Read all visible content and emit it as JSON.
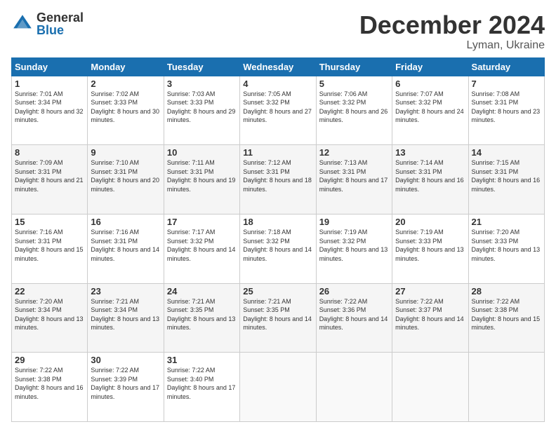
{
  "header": {
    "logo_general": "General",
    "logo_blue": "Blue",
    "month_title": "December 2024",
    "location": "Lyman, Ukraine"
  },
  "days_of_week": [
    "Sunday",
    "Monday",
    "Tuesday",
    "Wednesday",
    "Thursday",
    "Friday",
    "Saturday"
  ],
  "weeks": [
    [
      {
        "day": "1",
        "sunrise": "7:01 AM",
        "sunset": "3:34 PM",
        "daylight": "8 hours and 32 minutes."
      },
      {
        "day": "2",
        "sunrise": "7:02 AM",
        "sunset": "3:33 PM",
        "daylight": "8 hours and 30 minutes."
      },
      {
        "day": "3",
        "sunrise": "7:03 AM",
        "sunset": "3:33 PM",
        "daylight": "8 hours and 29 minutes."
      },
      {
        "day": "4",
        "sunrise": "7:05 AM",
        "sunset": "3:32 PM",
        "daylight": "8 hours and 27 minutes."
      },
      {
        "day": "5",
        "sunrise": "7:06 AM",
        "sunset": "3:32 PM",
        "daylight": "8 hours and 26 minutes."
      },
      {
        "day": "6",
        "sunrise": "7:07 AM",
        "sunset": "3:32 PM",
        "daylight": "8 hours and 24 minutes."
      },
      {
        "day": "7",
        "sunrise": "7:08 AM",
        "sunset": "3:31 PM",
        "daylight": "8 hours and 23 minutes."
      }
    ],
    [
      {
        "day": "8",
        "sunrise": "7:09 AM",
        "sunset": "3:31 PM",
        "daylight": "8 hours and 21 minutes."
      },
      {
        "day": "9",
        "sunrise": "7:10 AM",
        "sunset": "3:31 PM",
        "daylight": "8 hours and 20 minutes."
      },
      {
        "day": "10",
        "sunrise": "7:11 AM",
        "sunset": "3:31 PM",
        "daylight": "8 hours and 19 minutes."
      },
      {
        "day": "11",
        "sunrise": "7:12 AM",
        "sunset": "3:31 PM",
        "daylight": "8 hours and 18 minutes."
      },
      {
        "day": "12",
        "sunrise": "7:13 AM",
        "sunset": "3:31 PM",
        "daylight": "8 hours and 17 minutes."
      },
      {
        "day": "13",
        "sunrise": "7:14 AM",
        "sunset": "3:31 PM",
        "daylight": "8 hours and 16 minutes."
      },
      {
        "day": "14",
        "sunrise": "7:15 AM",
        "sunset": "3:31 PM",
        "daylight": "8 hours and 16 minutes."
      }
    ],
    [
      {
        "day": "15",
        "sunrise": "7:16 AM",
        "sunset": "3:31 PM",
        "daylight": "8 hours and 15 minutes."
      },
      {
        "day": "16",
        "sunrise": "7:16 AM",
        "sunset": "3:31 PM",
        "daylight": "8 hours and 14 minutes."
      },
      {
        "day": "17",
        "sunrise": "7:17 AM",
        "sunset": "3:32 PM",
        "daylight": "8 hours and 14 minutes."
      },
      {
        "day": "18",
        "sunrise": "7:18 AM",
        "sunset": "3:32 PM",
        "daylight": "8 hours and 14 minutes."
      },
      {
        "day": "19",
        "sunrise": "7:19 AM",
        "sunset": "3:32 PM",
        "daylight": "8 hours and 13 minutes."
      },
      {
        "day": "20",
        "sunrise": "7:19 AM",
        "sunset": "3:33 PM",
        "daylight": "8 hours and 13 minutes."
      },
      {
        "day": "21",
        "sunrise": "7:20 AM",
        "sunset": "3:33 PM",
        "daylight": "8 hours and 13 minutes."
      }
    ],
    [
      {
        "day": "22",
        "sunrise": "7:20 AM",
        "sunset": "3:34 PM",
        "daylight": "8 hours and 13 minutes."
      },
      {
        "day": "23",
        "sunrise": "7:21 AM",
        "sunset": "3:34 PM",
        "daylight": "8 hours and 13 minutes."
      },
      {
        "day": "24",
        "sunrise": "7:21 AM",
        "sunset": "3:35 PM",
        "daylight": "8 hours and 13 minutes."
      },
      {
        "day": "25",
        "sunrise": "7:21 AM",
        "sunset": "3:35 PM",
        "daylight": "8 hours and 14 minutes."
      },
      {
        "day": "26",
        "sunrise": "7:22 AM",
        "sunset": "3:36 PM",
        "daylight": "8 hours and 14 minutes."
      },
      {
        "day": "27",
        "sunrise": "7:22 AM",
        "sunset": "3:37 PM",
        "daylight": "8 hours and 14 minutes."
      },
      {
        "day": "28",
        "sunrise": "7:22 AM",
        "sunset": "3:38 PM",
        "daylight": "8 hours and 15 minutes."
      }
    ],
    [
      {
        "day": "29",
        "sunrise": "7:22 AM",
        "sunset": "3:38 PM",
        "daylight": "8 hours and 16 minutes."
      },
      {
        "day": "30",
        "sunrise": "7:22 AM",
        "sunset": "3:39 PM",
        "daylight": "8 hours and 17 minutes."
      },
      {
        "day": "31",
        "sunrise": "7:22 AM",
        "sunset": "3:40 PM",
        "daylight": "8 hours and 17 minutes."
      },
      null,
      null,
      null,
      null
    ]
  ]
}
